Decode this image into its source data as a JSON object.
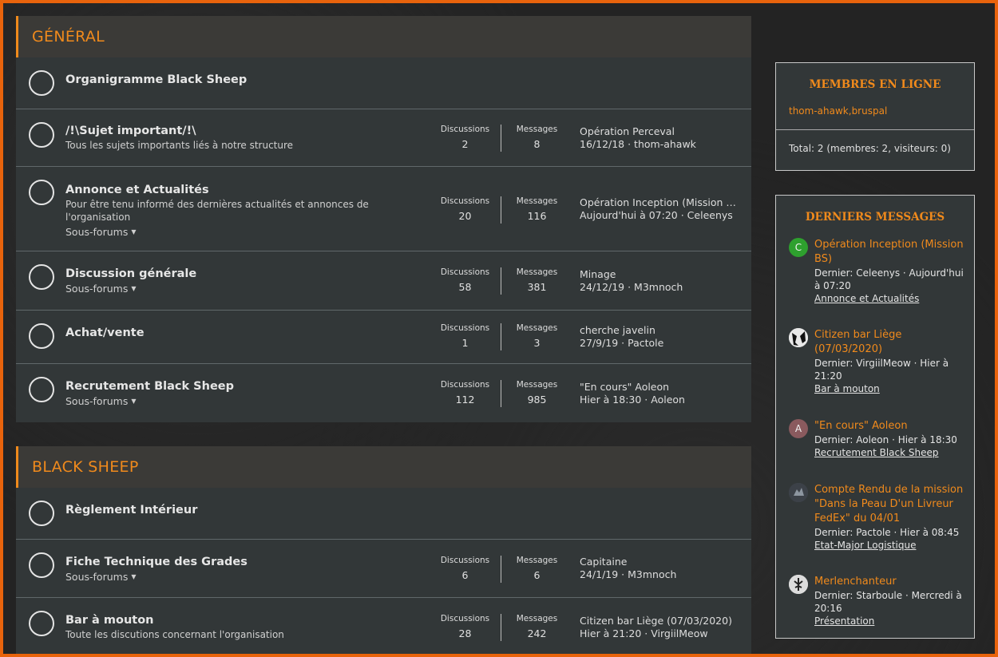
{
  "categories": [
    {
      "title": "GÉNÉRAL",
      "nodes": [
        {
          "title": "Organigramme Black Sheep"
        },
        {
          "title": "/!\\Sujet important/!\\",
          "desc": "Tous les sujets importants liés à notre structure",
          "discussions_label": "Discussions",
          "discussions": "2",
          "messages_label": "Messages",
          "messages": "8",
          "last_title": "Opération Perceval",
          "last_meta": "16/12/18 · thom-ahawk"
        },
        {
          "title": "Annonce et Actualités",
          "desc": "Pour être tenu informé des dernières actualités et annonces de l'organisation",
          "sub": "Sous-forums",
          "discussions_label": "Discussions",
          "discussions": "20",
          "messages_label": "Messages",
          "messages": "116",
          "last_title": "Opération Inception (Mission B...",
          "last_meta": "Aujourd'hui à 07:20 · Celeenys"
        },
        {
          "title": "Discussion générale",
          "sub": "Sous-forums",
          "discussions_label": "Discussions",
          "discussions": "58",
          "messages_label": "Messages",
          "messages": "381",
          "last_title": "Minage",
          "last_meta": "24/12/19 · M3mnoch"
        },
        {
          "title": "Achat/vente",
          "discussions_label": "Discussions",
          "discussions": "1",
          "messages_label": "Messages",
          "messages": "3",
          "last_title": "cherche javelin",
          "last_meta": "27/9/19 · Pactole"
        },
        {
          "title": "Recrutement Black Sheep",
          "sub": "Sous-forums",
          "discussions_label": "Discussions",
          "discussions": "112",
          "messages_label": "Messages",
          "messages": "985",
          "last_title": "\"En cours\" Aoleon",
          "last_meta": "Hier à 18:30 · Aoleon"
        }
      ]
    },
    {
      "title": "BLACK SHEEP",
      "nodes": [
        {
          "title": "Règlement Intérieur"
        },
        {
          "title": "Fiche Technique des Grades",
          "sub": "Sous-forums",
          "discussions_label": "Discussions",
          "discussions": "6",
          "messages_label": "Messages",
          "messages": "6",
          "last_title": "Capitaine",
          "last_meta": "24/1/19 · M3mnoch"
        },
        {
          "title": "Bar à mouton",
          "desc": "Toute les discutions concernant l'organisation",
          "discussions_label": "Discussions",
          "discussions": "28",
          "messages_label": "Messages",
          "messages": "242",
          "last_title": "Citizen bar Liège (07/03/2020)",
          "last_meta": "Hier à 21:20 · VirgiilMeow"
        }
      ]
    }
  ],
  "online": {
    "title": "MEMBRES EN LIGNE",
    "users": "thom-ahawk,bruspal",
    "total": "Total: 2 (membres: 2, visiteurs: 0)"
  },
  "latest": {
    "title": "DERNIERS MESSAGES",
    "posts": [
      {
        "avatar": "C",
        "avatar_color": "#2ea02e",
        "title": "Opération Inception (Mission BS)",
        "meta": "Dernier: Celeenys · Aujourd'hui à 07:20",
        "forum": "Annonce et Actualités"
      },
      {
        "avatar": "",
        "avatar_color": "#e8e8e8",
        "title": "Citizen bar Liège (07/03/2020)",
        "meta": "Dernier: VirgiilMeow · Hier à 21:20",
        "forum": "Bar à mouton"
      },
      {
        "avatar": "A",
        "avatar_color": "#8a5a5e",
        "title": "\"En cours\" Aoleon",
        "meta": "Dernier: Aoleon · Hier à 18:30",
        "forum": "Recrutement Black Sheep"
      },
      {
        "avatar": "",
        "avatar_color": "#4a5058",
        "title": "Compte Rendu de la mission \"Dans la Peau D'un Livreur FedEx\" du 04/01",
        "meta": "Dernier: Pactole · Hier à 08:45",
        "forum": "Etat-Major Logistique"
      },
      {
        "avatar": "",
        "avatar_color": "#dcdcdc",
        "title": "Merlenchanteur",
        "meta": "Dernier: Starboule · Mercredi à 20:16",
        "forum": "Présentation"
      }
    ]
  },
  "colors": {
    "accent": "#f08a1c",
    "frame": "#e8630c",
    "panel": "#323738",
    "header": "#3b3a37"
  }
}
